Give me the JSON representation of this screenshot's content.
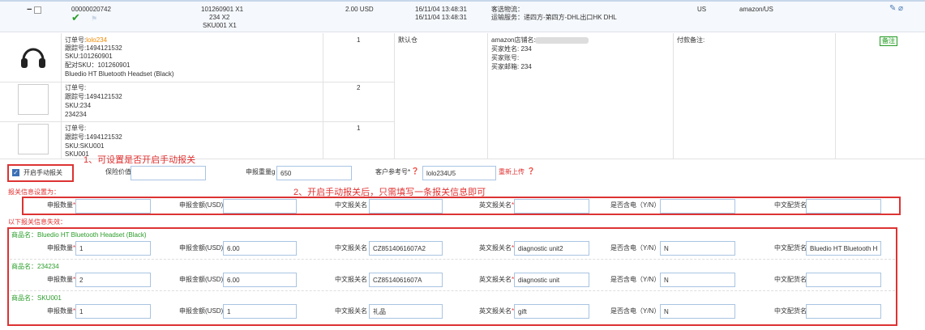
{
  "order": {
    "collapse_symbol": "−",
    "order_no": "00000020742",
    "items_summary": [
      "101260901 X1",
      "234 X2",
      "SKU001 X1"
    ],
    "amount": "2.00 USD",
    "date1": "16/11/04 13:48:31",
    "date2": "16/11/04 13:48:31",
    "logistics_label": "客选物流：",
    "shipping_service": "运输服务：递四方-第四方-DHL出口HK DHL",
    "country": "US",
    "platform": "amazon/US"
  },
  "products": [
    {
      "order_label": "订单号:",
      "order_value": "lolo234",
      "tracking": "跟踪号:1494121532",
      "sku": "SKU:101260901",
      "paired_sku": "配对SKU：101260901",
      "name": "Bluedio HT Bluetooth Headset (Black)",
      "qty": "1"
    },
    {
      "order_label": "订单号:",
      "order_value": "",
      "tracking": "跟踪号:1494121532",
      "sku": "SKU:234",
      "paired_sku": "234234",
      "name": "",
      "qty": "2"
    },
    {
      "order_label": "订单号:",
      "order_value": "",
      "tracking": "跟踪号:1494121532",
      "sku": "SKU:SKU001",
      "paired_sku": "SKU001",
      "name": "",
      "qty": "1"
    }
  ],
  "warehouse": "默认仓",
  "buyer": {
    "store": "amazon店铺名:",
    "name": "买家姓名: 234",
    "account": "买家账号:",
    "email": "买家邮箱: 234"
  },
  "payment_note": "付款备注:",
  "note_button": "备注",
  "customs": {
    "manual_label": "开启手动报关",
    "insured_label": "保险价值",
    "weight_label": "申报重量g",
    "weight_value": "650",
    "ref_label": "客户参考号*",
    "ref_value": "lolo234U5",
    "reupload": "重新上传",
    "settings_title": "报关信息设置为：",
    "invalid_title": "以下报关信息失效："
  },
  "annotations": {
    "a1": "1、可设置是否开启手动报关",
    "a2": "2、开启手动报关后，只需填写一条报关信息即可"
  },
  "labels": {
    "qty": "申报数量",
    "amount": "申报金额(USD)",
    "cn_name": "中文报关名",
    "en_name": "英文报关名",
    "battery": "是否含电（Y/N）",
    "cn_dist": "中文配货名",
    "req": "*"
  },
  "goods": [
    {
      "title": "商品名：Bluedio HT Bluetooth Headset (Black)",
      "qty": "1",
      "amount": "6.00",
      "cn_name": "CZ8514061607A2",
      "en_name": "diagnostic unit2",
      "battery": "N",
      "cn_dist": "Bluedio HT Bluetooth He"
    },
    {
      "title": "商品名：234234",
      "qty": "2",
      "amount": "6.00",
      "cn_name": "CZ8514061607A",
      "en_name": "diagnostic unit",
      "battery": "N",
      "cn_dist": ""
    },
    {
      "title": "商品名：SKU001",
      "qty": "1",
      "amount": "1",
      "cn_name": "礼品",
      "en_name": "gift",
      "battery": "N",
      "cn_dist": ""
    }
  ]
}
